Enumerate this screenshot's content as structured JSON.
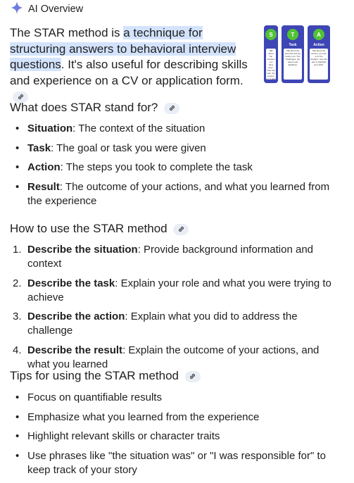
{
  "header": {
    "title": "AI Overview"
  },
  "intro": {
    "part1": "The STAR method is ",
    "highlight": "a technique for structuring answers to behavioral interview questions",
    "part2": ". It's also useful for describing skills and experience on a CV or application form."
  },
  "thumbnail": {
    "cards": [
      {
        "letter": "S",
        "caption": "",
        "body": "Talk about the situation you have been. Then the step, the context, ie a skill flow"
      },
      {
        "letter": "T",
        "caption": "Task",
        "body": "Talk about the task that was set before you. The challenges, the issues and deadlines."
      },
      {
        "letter": "A",
        "caption": "Action",
        "body": "Talk about the actions you took to fix the situation. Use this part to highlight your skills."
      }
    ]
  },
  "sections": [
    {
      "heading": "What does STAR stand for?",
      "items": [
        {
          "bold": "Situation",
          "text": ": The context of the situation"
        },
        {
          "bold": "Task",
          "text": ": The goal or task you were given"
        },
        {
          "bold": "Action",
          "text": ": The steps you took to complete the task"
        },
        {
          "bold": "Result",
          "text": ": The outcome of your actions, and what you learned from the experience"
        }
      ]
    },
    {
      "heading": "How to use the STAR method",
      "items": [
        {
          "marker": "1.",
          "bold": "Describe the situation",
          "text": ": Provide background information and context"
        },
        {
          "marker": "2.",
          "bold": "Describe the task",
          "text": ": Explain your role and what you were trying to achieve"
        },
        {
          "marker": "3.",
          "bold": "Describe the action",
          "text": ": Explain what you did to address the challenge"
        },
        {
          "marker": "4.",
          "bold": "Describe the result",
          "text": ": Explain the outcome of your actions, and what you learned"
        }
      ]
    },
    {
      "heading": "Tips for using the STAR method",
      "items": [
        {
          "text": "Focus on quantifiable results"
        },
        {
          "text": "Emphasize what you learned from the experience"
        },
        {
          "text": "Highlight relevant skills or character traits"
        },
        {
          "text": "Use phrases like \"the situation was\" or \"I was responsible for\" to keep track of your story"
        }
      ]
    }
  ],
  "colors": {
    "accent": "#4285f4",
    "highlight": "#d3e3fd",
    "chip": "#e9eef6",
    "card": "#3e46b5",
    "card_circle": "#52c234"
  },
  "icons": {
    "header": "sparkle-icon",
    "chip": "link-icon"
  }
}
